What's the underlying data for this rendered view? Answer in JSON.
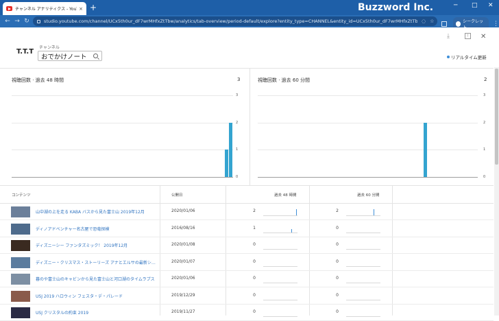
{
  "browser": {
    "tab_title": "チャンネル アナリティクス - YouTube Studio",
    "tab_close": "×",
    "new_tab": "+",
    "brand": "Buzzword Inc.",
    "url": "studio.youtube.com/channel/UCx5th0ur_dF7wrMHfxZtTbw/analytics/tab-overview/period-default/explore?entity_type=CHANNEL&entity_id=UCx5th0ur_dF7wrMHfxZtTbw...",
    "incognito_label": "シークレット",
    "win_min": "─",
    "win_max": "□",
    "win_close": "✕",
    "back": "←",
    "forward": "→",
    "reload": "↻",
    "kebab": "⋮"
  },
  "header": {
    "logo": "T.T.T",
    "channel_label": "チャンネル",
    "channel_value": "おでかけノート",
    "download_icon": "⤓",
    "feedback_icon": "!",
    "close_icon": "✕",
    "realtime_label": "リアルタイム更新"
  },
  "chart_data": [
    {
      "type": "bar",
      "title": "視聴回数 · 過去 48 時間",
      "total": "3",
      "ylim": [
        0,
        3
      ],
      "yticks": [
        "3",
        "2",
        "1",
        "0"
      ],
      "num_bins": 48,
      "bars": [
        {
          "bin": 46,
          "value": 1
        },
        {
          "bin": 47,
          "value": 2
        }
      ]
    },
    {
      "type": "bar",
      "title": "視聴回数 · 過去 60 分間",
      "total": "2",
      "ylim": [
        0,
        3
      ],
      "yticks": [
        "3",
        "2",
        "1",
        "0"
      ],
      "num_bins": 60,
      "bars": [
        {
          "bin": 45,
          "value": 2
        }
      ]
    }
  ],
  "table": {
    "headers": [
      "コンテンツ",
      "公開日",
      "過去 48 時間",
      "過去 60 分間"
    ],
    "rows": [
      {
        "title": "山中湖の上を走る KABA バスから見た富士山 2019年12月",
        "date": "2020/01/06",
        "h48": "2",
        "m60": "2",
        "h48_bar": 1.0,
        "m60_bar": 1.0,
        "thumb": "#6b7f9a"
      },
      {
        "title": "ディノアドベンチャー名古屋で恐竜探検",
        "date": "2016/08/16",
        "h48": "1",
        "m60": "0",
        "h48_bar": 0.5,
        "m60_bar": 0,
        "thumb": "#4e6b8c"
      },
      {
        "title": "ディズニーシー ファンタズミック！ 2019年12月",
        "date": "2020/01/08",
        "h48": "0",
        "m60": "0",
        "h48_bar": 0,
        "m60_bar": 0,
        "thumb": "#3a2a20"
      },
      {
        "title": "ディズニー・クリスマス・ストーリーズ アナとエルサの最新ショー 2019",
        "date": "2020/01/07",
        "h48": "0",
        "m60": "0",
        "h48_bar": 0,
        "m60_bar": 0,
        "thumb": "#5b7c9e"
      },
      {
        "title": "暮のや富士山のキャビンから見た富士山と河口湖のタイムラプス",
        "date": "2020/01/06",
        "h48": "0",
        "m60": "0",
        "h48_bar": 0,
        "m60_bar": 0,
        "thumb": "#7d8fa3"
      },
      {
        "title": "USJ 2019 ハロウィン フェスタ・デ・パレード",
        "date": "2019/12/29",
        "h48": "0",
        "m60": "0",
        "h48_bar": 0,
        "m60_bar": 0,
        "thumb": "#8a5a4a"
      },
      {
        "title": "USJ クリスタルの約束 2019",
        "date": "2019/11/27",
        "h48": "0",
        "m60": "0",
        "h48_bar": 0,
        "m60_bar": 0,
        "thumb": "#2a2a44"
      }
    ]
  }
}
